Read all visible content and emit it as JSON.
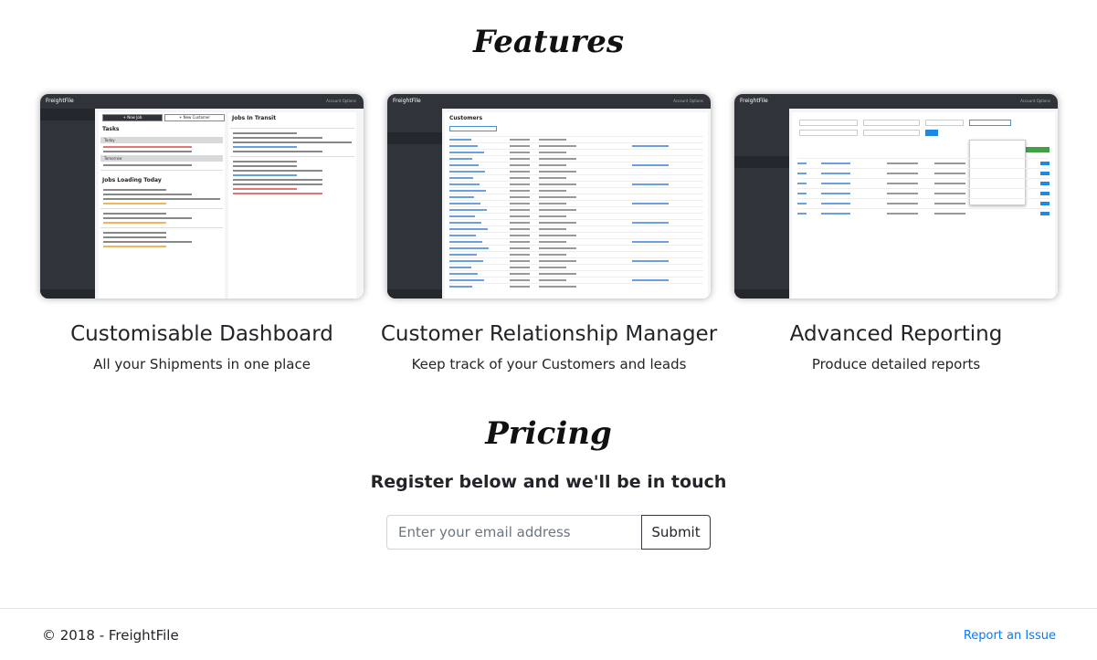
{
  "features": {
    "title": "Features",
    "cards": [
      {
        "heading": "Customisable Dashboard",
        "subtitle": "All your Shipments in one place"
      },
      {
        "heading": "Customer Relationship Manager",
        "subtitle": "Keep track of your Customers and leads"
      },
      {
        "heading": "Advanced Reporting",
        "subtitle": "Produce detailed reports"
      }
    ]
  },
  "screenshots": {
    "app_name": "FreightFile",
    "top_right": "Account  Options",
    "dashboard": {
      "new_job": "+ New Job",
      "new_customer": "+ New Customer",
      "tasks": "Tasks",
      "today": "Today",
      "tomorrow": "Tomorrow",
      "jobs_loading": "Jobs Loading Today",
      "jobs_in_transit": "Jobs In Transit"
    },
    "crm": {
      "title": "Customers"
    }
  },
  "pricing": {
    "title": "Pricing",
    "subtitle": "Register below and we'll be in touch",
    "email_placeholder": "Enter your email address",
    "submit_label": "Submit"
  },
  "footer": {
    "copyright": "© 2018 - FreightFile",
    "report_link": "Report an Issue"
  },
  "colors": {
    "link": "#007bff",
    "app_dark": "#30343a"
  }
}
